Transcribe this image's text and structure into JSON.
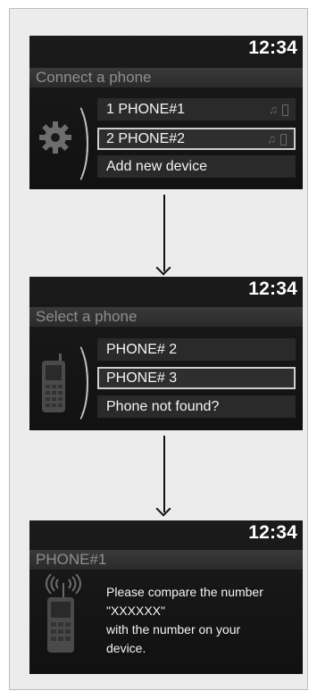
{
  "screens": [
    {
      "clock": "12:34",
      "title": "Connect a phone",
      "icon": "gear-icon",
      "items": [
        {
          "label": "1 PHONE#1",
          "selected": false,
          "icons": [
            "music-icon",
            "phone-icon"
          ]
        },
        {
          "label": "2 PHONE#2",
          "selected": true,
          "icons": [
            "music-icon",
            "phone-icon"
          ]
        },
        {
          "label": "Add new device",
          "selected": false,
          "icons": []
        }
      ]
    },
    {
      "clock": "12:34",
      "title": "Select a phone",
      "icon": "mobile-phone-icon",
      "items": [
        {
          "label": "PHONE# 2",
          "selected": false
        },
        {
          "label": "PHONE# 3",
          "selected": true
        },
        {
          "label": "Phone not found?",
          "selected": false
        }
      ]
    },
    {
      "clock": "12:34",
      "title": "PHONE#1",
      "icon": "phone-signal-icon",
      "message": [
        "Please compare the number",
        "\"XXXXXX\"",
        "with the number on your",
        "device."
      ]
    }
  ],
  "colors": {
    "screen_bg": "#111111",
    "title_text": "#8e8e8e",
    "highlight_border": "#cfcfcf"
  }
}
